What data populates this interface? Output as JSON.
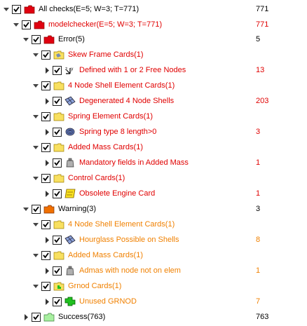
{
  "tree": [
    {
      "label": "All checks(E=5; W=3; T=771)",
      "count": "771",
      "color": "blk",
      "folder": "#e00010"
    },
    {
      "label": "modelchecker(E=5; W=3; T=771)",
      "count": "771",
      "color": "red",
      "folder": "#e00010"
    },
    {
      "label": "Error(5)",
      "count": "5",
      "color": "blk",
      "folder": "#e00010"
    },
    {
      "label": "Skew Frame Cards(1)",
      "count": "",
      "color": "red"
    },
    {
      "label": "Defined with 1 or 2 Free Nodes",
      "count": "13",
      "color": "red"
    },
    {
      "label": "4 Node Shell Element Cards(1)",
      "count": "",
      "color": "red"
    },
    {
      "label": "Degenerated 4 Node Shells",
      "count": "203",
      "color": "red"
    },
    {
      "label": "Spring Element Cards(1)",
      "count": "",
      "color": "red"
    },
    {
      "label": "Spring type 8 length>0",
      "count": "3",
      "color": "red"
    },
    {
      "label": "Added Mass Cards(1)",
      "count": "",
      "color": "red"
    },
    {
      "label": "Mandatory fields in Added Mass",
      "count": "1",
      "color": "red"
    },
    {
      "label": "Control Cards(1)",
      "count": "",
      "color": "red"
    },
    {
      "label": "Obsolete Engine Card",
      "count": "1",
      "color": "red"
    },
    {
      "label": "Warning(3)",
      "count": "3",
      "color": "blk",
      "folder": "#f07000"
    },
    {
      "label": "4 Node Shell Element Cards(1)",
      "count": "",
      "color": "orange"
    },
    {
      "label": "Hourglass Possible on Shells",
      "count": "8",
      "color": "orange"
    },
    {
      "label": "Added Mass Cards(1)",
      "count": "",
      "color": "orange"
    },
    {
      "label": "Admas with node not on elem",
      "count": "1",
      "color": "orange"
    },
    {
      "label": "Grnod Cards(1)",
      "count": "",
      "color": "orange"
    },
    {
      "label": "Unused GRNOD",
      "count": "7",
      "color": "orange"
    },
    {
      "label": "Success(763)",
      "count": "763",
      "color": "blk",
      "folder": "#a8f0a0"
    }
  ]
}
